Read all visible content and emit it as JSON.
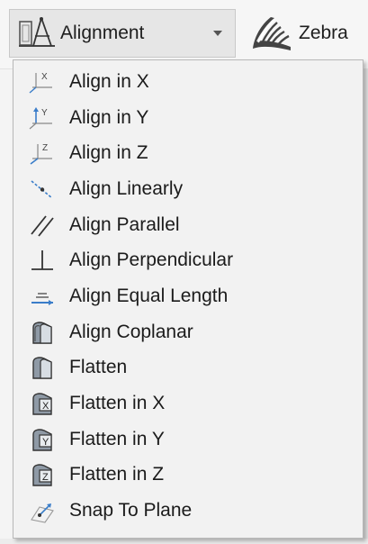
{
  "toolbar": {
    "alignment": {
      "label": "Alignment",
      "icon": "align-icon",
      "caret_icon": "chevron-down-icon"
    },
    "zebra": {
      "label": "Zebra",
      "icon": "zebra-stripes-icon"
    }
  },
  "menu": {
    "items": [
      {
        "label": "Align in X",
        "icon": "align-x-icon"
      },
      {
        "label": "Align in Y",
        "icon": "align-y-icon"
      },
      {
        "label": "Align in Z",
        "icon": "align-z-icon"
      },
      {
        "label": "Align Linearly",
        "icon": "align-linearly-icon"
      },
      {
        "label": "Align Parallel",
        "icon": "align-parallel-icon"
      },
      {
        "label": "Align Perpendicular",
        "icon": "align-perpendicular-icon"
      },
      {
        "label": "Align Equal Length",
        "icon": "align-equal-length-icon"
      },
      {
        "label": "Align Coplanar",
        "icon": "align-coplanar-icon"
      },
      {
        "label": "Flatten",
        "icon": "flatten-icon"
      },
      {
        "label": "Flatten in X",
        "icon": "flatten-x-icon"
      },
      {
        "label": "Flatten in Y",
        "icon": "flatten-y-icon"
      },
      {
        "label": "Flatten in Z",
        "icon": "flatten-z-icon"
      },
      {
        "label": "Snap To Plane",
        "icon": "snap-to-plane-icon"
      }
    ]
  },
  "colors": {
    "toolbar_bg": "#f6f6f6",
    "button_bg": "#e6e6e6",
    "menu_bg": "#f2f2f2",
    "icon_blue": "#3a7dc9",
    "icon_gray": "#606060"
  }
}
